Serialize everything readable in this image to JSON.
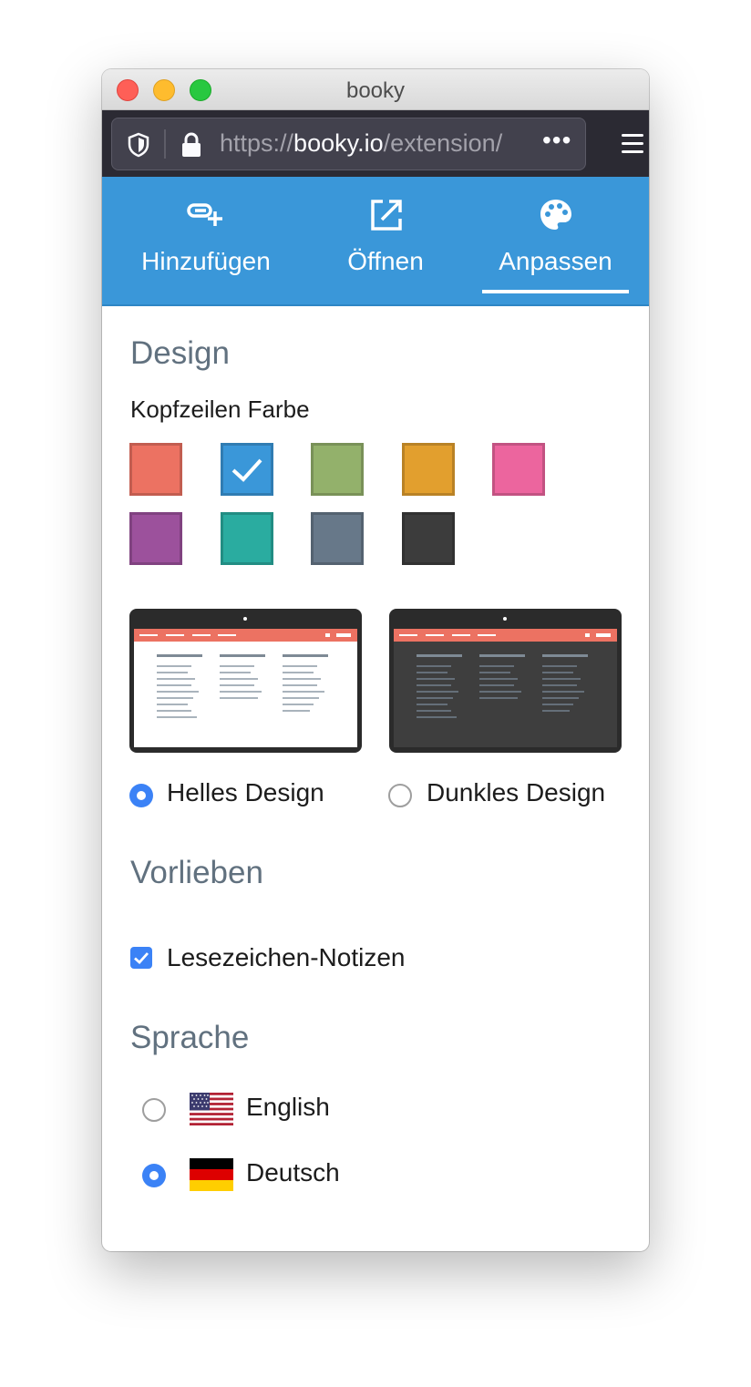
{
  "window": {
    "title": "booky"
  },
  "urlbar": {
    "url_scheme": "https://",
    "url_host": "booky.io",
    "url_path": "/extension/",
    "more": "•••"
  },
  "nav": {
    "tabs": [
      {
        "label": "Hinzufügen",
        "icon": "add-link-icon"
      },
      {
        "label": "Öffnen",
        "icon": "open-external-icon"
      },
      {
        "label": "Anpassen",
        "icon": "palette-icon",
        "active": true
      }
    ]
  },
  "design": {
    "heading": "Design",
    "header_color_label": "Kopfzeilen Farbe",
    "colors": [
      "#ec7262",
      "#3a97d9",
      "#93b16b",
      "#e29f2e",
      "#ec659e",
      "#9c519c",
      "#2aaca0",
      "#677889",
      "#3c3c3c"
    ],
    "selected_color_index": 1,
    "themes": [
      {
        "label": "Helles Design",
        "selected": true
      },
      {
        "label": "Dunkles Design",
        "selected": false
      }
    ]
  },
  "preferences": {
    "heading": "Vorlieben",
    "bookmark_notes_label": "Lesezeichen-Notizen",
    "bookmark_notes_checked": true
  },
  "language": {
    "heading": "Sprache",
    "options": [
      {
        "label": "English",
        "flag": "us-flag-icon",
        "selected": false
      },
      {
        "label": "Deutsch",
        "flag": "de-flag-icon",
        "selected": true
      }
    ]
  }
}
